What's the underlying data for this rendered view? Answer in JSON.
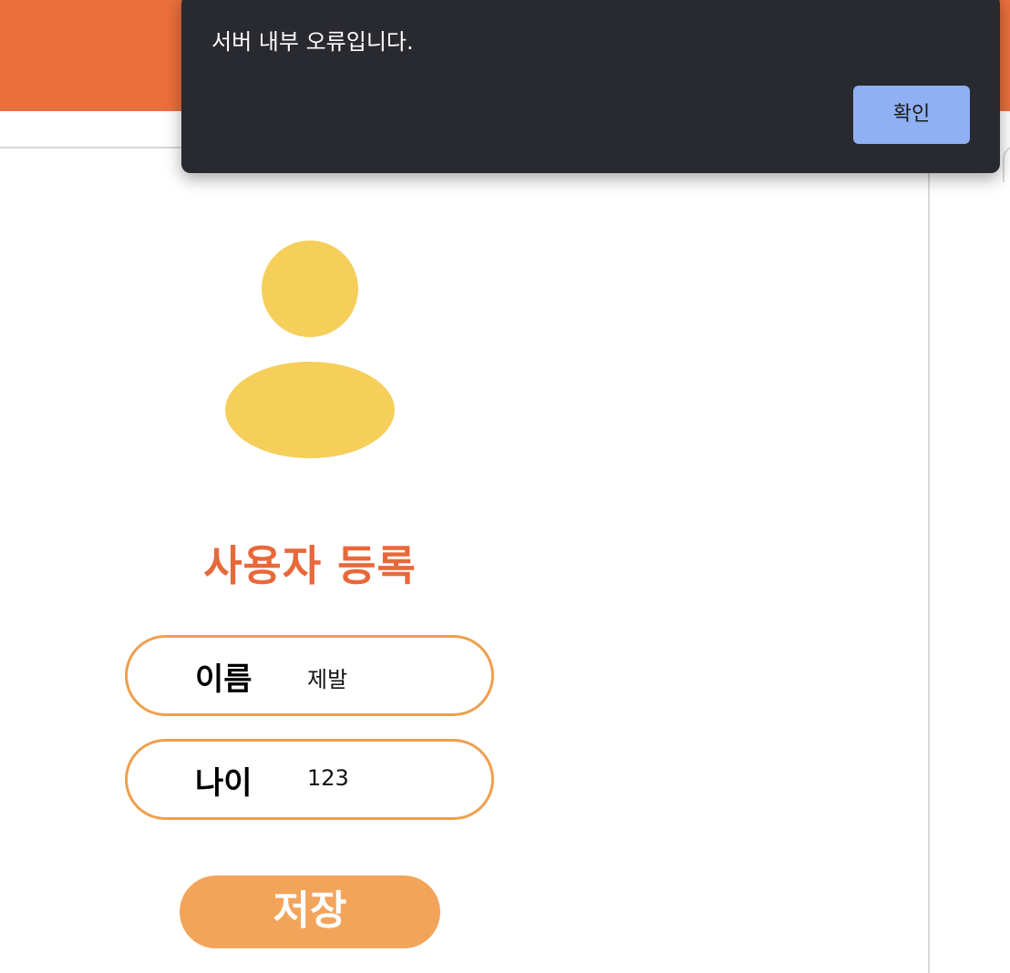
{
  "header": {
    "brand_color": "#eb6f3c"
  },
  "avatar": {
    "icon": "user-icon",
    "color": "#f6ce5a"
  },
  "form": {
    "title": "사용자 등록",
    "name_label": "이름",
    "name_value": "제발",
    "age_label": "나이",
    "age_value": "123",
    "save_label": "저장",
    "accent_color": "#e8683a",
    "border_color": "#eda04d",
    "button_color": "#f3a45b"
  },
  "dialog": {
    "message": "서버 내부 오류입니다.",
    "confirm_label": "확인",
    "background": "#292a2f",
    "button_color": "#8fb0f3"
  }
}
